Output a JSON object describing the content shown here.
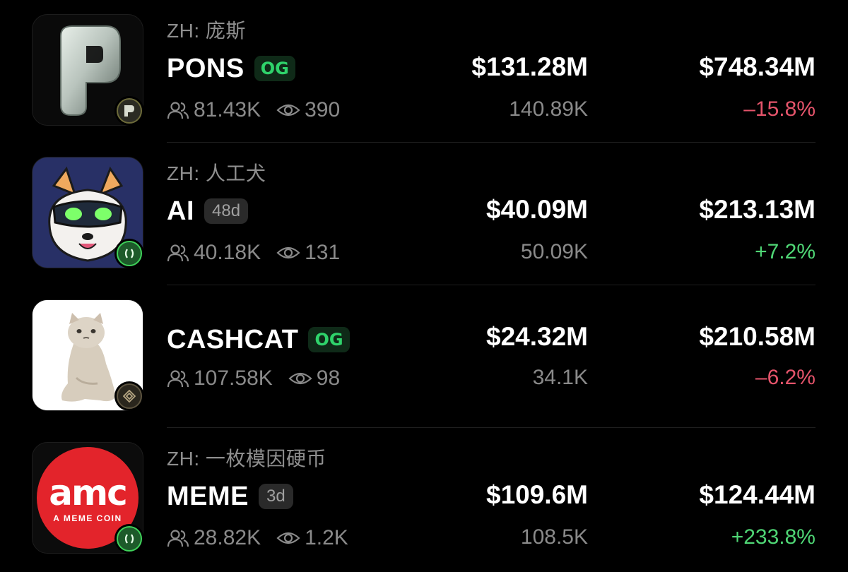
{
  "colors": {
    "background": "#000000",
    "positive": "#4fd675",
    "negative": "#e5546b",
    "muted": "#8a8a8a",
    "og_tag_text": "#2fd36b"
  },
  "tokens": [
    {
      "zh_label": "ZH: 庞斯",
      "ticker": "PONS",
      "tag": "OG",
      "tag_type": "og",
      "holders": "81.43K",
      "views": "390",
      "price": "$131.28M",
      "volume": "140.89K",
      "market_cap": "$748.34M",
      "change": "–15.8%",
      "change_direction": "negative",
      "logo_icon": "silver-p-logo",
      "chain_icon": "p-chain-icon"
    },
    {
      "zh_label": "ZH: 人工犬",
      "ticker": "AI",
      "tag": "48d",
      "tag_type": "age",
      "holders": "40.18K",
      "views": "131",
      "price": "$40.09M",
      "volume": "50.09K",
      "market_cap": "$213.13M",
      "change": "+7.2%",
      "change_direction": "positive",
      "logo_icon": "robot-shiba-logo",
      "chain_icon": "green-chain-icon"
    },
    {
      "zh_label": "",
      "ticker": "CASHCAT",
      "tag": "OG",
      "tag_type": "og",
      "holders": "107.58K",
      "views": "98",
      "price": "$24.32M",
      "volume": "34.1K",
      "market_cap": "$210.58M",
      "change": "–6.2%",
      "change_direction": "negative",
      "logo_icon": "sad-cat-logo",
      "chain_icon": "diamond-chain-icon"
    },
    {
      "zh_label": "ZH: 一枚模因硬币",
      "ticker": "MEME",
      "tag": "3d",
      "tag_type": "age",
      "holders": "28.82K",
      "views": "1.2K",
      "price": "$109.6M",
      "volume": "108.5K",
      "market_cap": "$124.44M",
      "change": "+233.8%",
      "change_direction": "positive",
      "logo_icon": "amc-meme-coin-logo",
      "logo_text": "amc",
      "logo_subtext": "A MEME COIN",
      "chain_icon": "green-chain-icon"
    }
  ]
}
